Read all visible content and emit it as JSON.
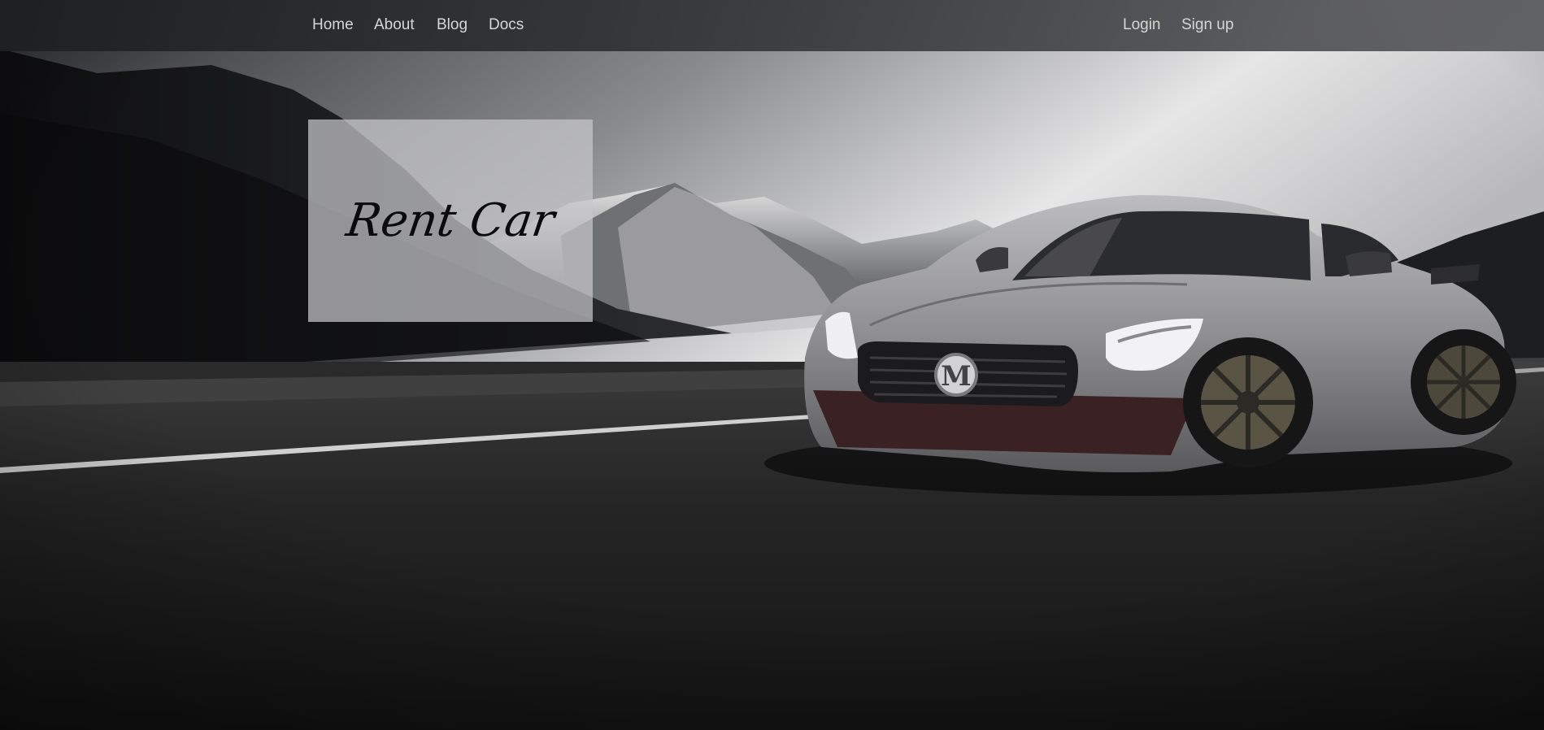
{
  "nav": {
    "left": [
      {
        "label": "Home"
      },
      {
        "label": "About"
      },
      {
        "label": "Blog"
      },
      {
        "label": "Docs"
      }
    ],
    "right": [
      {
        "label": "Login"
      },
      {
        "label": "Sign up"
      }
    ]
  },
  "hero": {
    "title": "Rent Car",
    "car_badge": "M"
  },
  "colors": {
    "nav_bg": "#2a2b2e",
    "nav_text": "#d6d6d6",
    "card_bg": "#c8c8ca",
    "title": "#0b0b0b"
  }
}
